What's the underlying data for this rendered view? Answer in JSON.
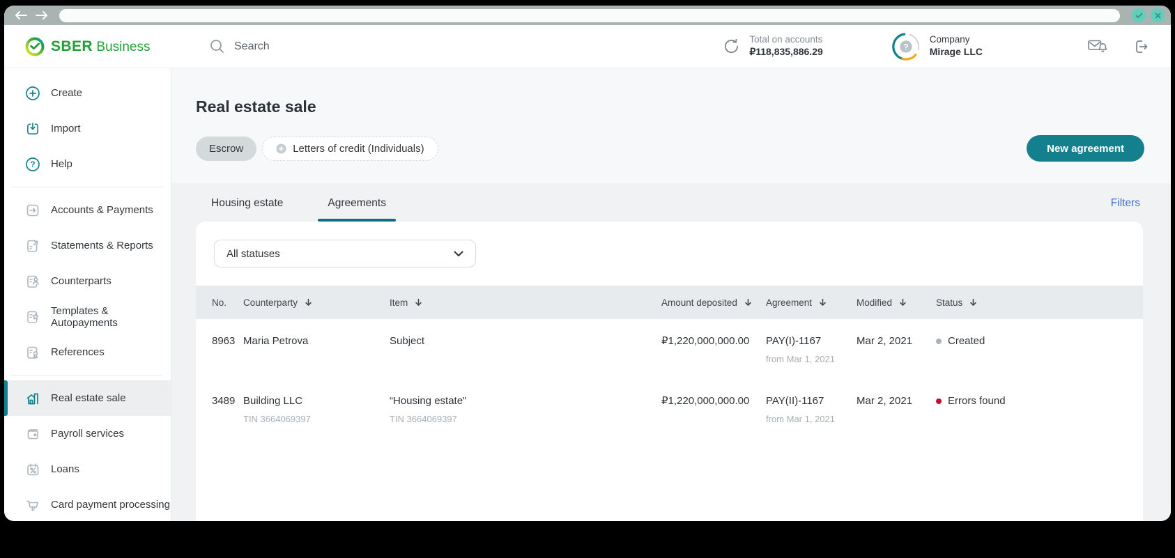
{
  "browser": {
    "back_icon": "arrow-left",
    "forward_icon": "arrow-right",
    "address_value": "",
    "window_buttons": {
      "confirm_icon": "check",
      "close_icon": "x"
    }
  },
  "header": {
    "brand": "SBER",
    "brand_suffix": "Business",
    "search_placeholder": "Search",
    "accounts_total": {
      "label": "Total on accounts",
      "value": "₽118,835,886.29",
      "icon": "refresh-icon"
    },
    "company": {
      "label": "Company",
      "name": "Mirage LLC",
      "icon": "company-avatar"
    },
    "notifications_icon": "mail-bell-icon",
    "logout_icon": "logout-icon"
  },
  "sidebar": {
    "top": [
      {
        "label": "Create",
        "icon": "plus-circle-icon"
      },
      {
        "label": "Import",
        "icon": "import-icon"
      },
      {
        "label": "Help",
        "icon": "help-circle-icon"
      }
    ],
    "menu": [
      {
        "label": "Accounts & Payments",
        "icon": "square-arrow-icon"
      },
      {
        "label": "Statements & Reports",
        "icon": "document-export-icon"
      },
      {
        "label": "Counterparts",
        "icon": "document-person-icon"
      },
      {
        "label": "Templates & Autopayments",
        "icon": "document-star-icon"
      },
      {
        "label": "References",
        "icon": "document-certificate-icon"
      }
    ],
    "tools": [
      {
        "label": "Real estate sale",
        "icon": "house-icon",
        "active": true
      },
      {
        "label": "Payroll services",
        "icon": "wallet-icon",
        "active": false
      },
      {
        "label": "Loans",
        "icon": "calendar-percent-icon",
        "active": false
      },
      {
        "label": "Card payment processing",
        "icon": "cart-icon",
        "active": false
      }
    ]
  },
  "page": {
    "title": "Real estate sale",
    "product_chips": [
      {
        "label": "Escrow",
        "selected": true
      },
      {
        "label": "Letters of credit (Individuals)",
        "selected": false,
        "icon": "plus-icon"
      }
    ],
    "new_agreement_button": "New agreement",
    "tabs": [
      {
        "label": "Housing estate",
        "active": false
      },
      {
        "label": "Agreements",
        "active": true
      }
    ],
    "filters_link": "Filters",
    "status_filter_value": "All statuses"
  },
  "table": {
    "columns": [
      {
        "label": "No.",
        "sortable": false
      },
      {
        "label": "Counterparty",
        "sortable": true
      },
      {
        "label": "Item",
        "sortable": true
      },
      {
        "label": "Amount deposited",
        "sortable": true
      },
      {
        "label": "Agreement",
        "sortable": true
      },
      {
        "label": "Modified",
        "sortable": true
      },
      {
        "label": "Status",
        "sortable": true
      }
    ],
    "rows": [
      {
        "no": "8963",
        "counterparty": "Maria Petrova",
        "item": "Subject",
        "amount": "₽1,220,000,000.00",
        "agreement": "PAY(I)-1167",
        "agreement_sub": "from Mar 1, 2021",
        "modified": "Mar 2, 2021",
        "status": {
          "label": "Created",
          "dot_color": "#A9B3BC"
        }
      },
      {
        "no": "3489",
        "counterparty": "Building LLC",
        "counterparty_sub": "TIN 3664069397",
        "item": "“Housing estate”",
        "item_sub": "TIN 3664069397",
        "amount": "₽1,220,000,000.00",
        "agreement": "PAY(II)-1167",
        "agreement_sub": "from Mar 1, 2021",
        "modified": "Mar 2, 2021",
        "status": {
          "label": "Errors found",
          "dot_color": "#C11030"
        }
      }
    ]
  },
  "colors": {
    "accent_teal": "#14808E",
    "tab_underline": "#0F6F83",
    "brand_green": "#21A038",
    "link_blue": "#3B6EDB",
    "status_created_dot": "#A9B3BC",
    "status_error_dot": "#C11030"
  }
}
